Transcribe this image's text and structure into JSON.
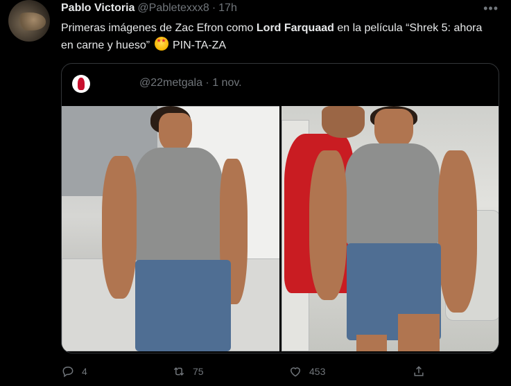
{
  "tweet": {
    "author_name": "Pablo Victoria",
    "author_handle": "@Pabletexxx8",
    "separator": "·",
    "time": "17h",
    "text_part1": "Primeras imágenes de Zac Efron como ",
    "text_bold": "Lord Farquaad",
    "text_part2": " en la película “Shrek 5: ahora en carne y hueso” ",
    "text_part3": " PIN-TA-ZA",
    "emoji_icon": "star-struck-emoji",
    "more_icon": "more-icon"
  },
  "quote": {
    "handle": "@22metgala",
    "separator": "·",
    "date": "1 nov.",
    "photos": [
      {
        "name": "photo-left",
        "description_icon": "image"
      },
      {
        "name": "photo-right",
        "description_icon": "image"
      }
    ]
  },
  "actions": {
    "reply_count": "4",
    "retweet_count": "75",
    "like_count": "453",
    "share_count": ""
  },
  "colors": {
    "background": "#000000",
    "text": "#e7e9ea",
    "secondary": "#71767b",
    "border": "#333639"
  }
}
